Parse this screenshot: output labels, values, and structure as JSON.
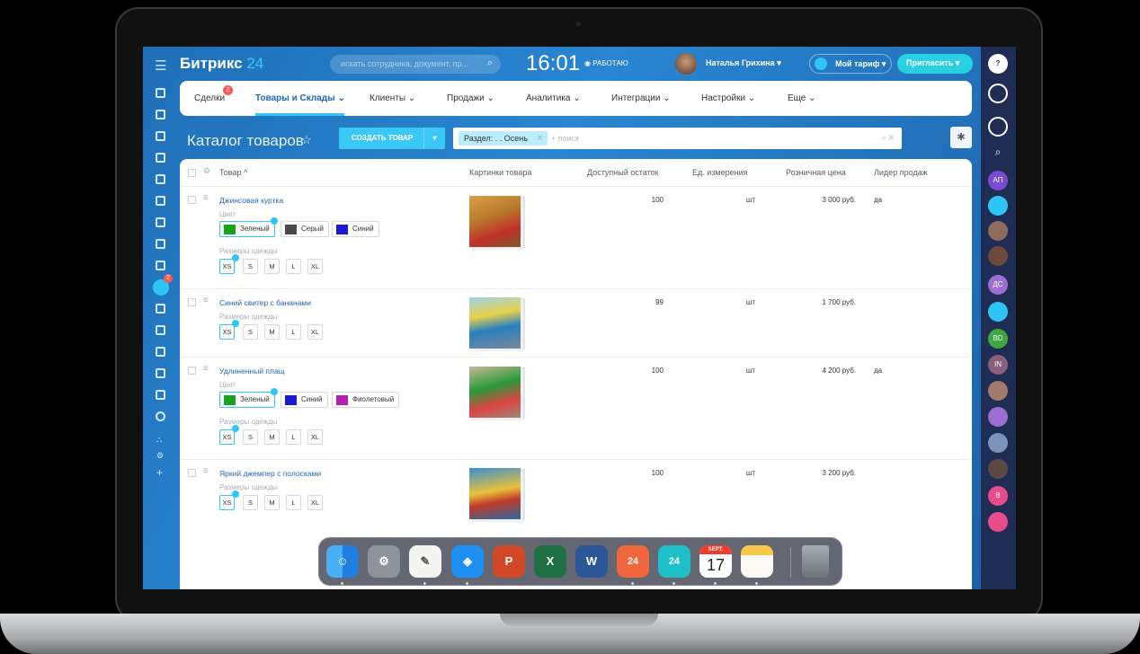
{
  "header": {
    "brand": "Битрикс",
    "brand_suffix": "24",
    "search_placeholder": "искать сотрудника, документ, пр...",
    "clock": "16:01",
    "status": "◉ РАБОТАЮ",
    "user_name": "Наталья Грихина ▾",
    "tariff": "Мой тариф ▾",
    "invite": "Пригласить ▾"
  },
  "tabs": [
    {
      "label": "Сделки",
      "badge": "2"
    },
    {
      "label": "Товары и Склады ⌄"
    },
    {
      "label": "Клиенты ⌄"
    },
    {
      "label": "Продажи ⌄"
    },
    {
      "label": "Аналитика ⌄"
    },
    {
      "label": "Интеграции ⌄"
    },
    {
      "label": "Настройки ⌄"
    },
    {
      "label": "Еще ⌄"
    }
  ],
  "page": {
    "title": "Каталог товаров",
    "create_button": "СОЗДАТЬ ТОВАР",
    "filter_chip": "Раздел: . . Осень",
    "filter_placeholder": "+ поиск",
    "left_bar_badge": "2"
  },
  "columns": [
    "Товар ^",
    "Картинки товара",
    "Доступный остаток",
    "Ед. измерения",
    "Розничная цена",
    "Лидер продаж"
  ],
  "labels": {
    "color": "Цвет",
    "sizes": "Размеры одежды"
  },
  "sizes": [
    "XS",
    "S",
    "M",
    "L",
    "XL"
  ],
  "products": [
    {
      "name": "Джинсовая куртка",
      "stock": "100",
      "unit": "шт",
      "price": "3 000 руб.",
      "leader": "да",
      "colors": [
        {
          "label": "Зеленый",
          "color": "#1aa31a"
        },
        {
          "label": "Серый",
          "color": "#4a4a4a"
        },
        {
          "label": "Синий",
          "color": "#1a1ad0"
        }
      ]
    },
    {
      "name": "Синий свитер с бананами",
      "stock": "99",
      "unit": "шт",
      "price": "1 700 руб.",
      "leader": ""
    },
    {
      "name": "Удлиненный плащ",
      "stock": "100",
      "unit": "шт",
      "price": "4 200 руб.",
      "leader": "да",
      "colors": [
        {
          "label": "Зеленый",
          "color": "#1aa31a"
        },
        {
          "label": "Синий",
          "color": "#1a1ad0"
        },
        {
          "label": "Фиолетовый",
          "color": "#b41fb4"
        }
      ]
    },
    {
      "name": "Яркий джемпер с полосками",
      "stock": "100",
      "unit": "шт",
      "price": "3 200 руб.",
      "leader": ""
    }
  ],
  "right_bar": [
    "АП",
    "ДС",
    "BD",
    "IN",
    "В"
  ],
  "dock": {
    "calendar_month": "SEPT.",
    "calendar_day": "17",
    "bitrix_badge": "24"
  }
}
